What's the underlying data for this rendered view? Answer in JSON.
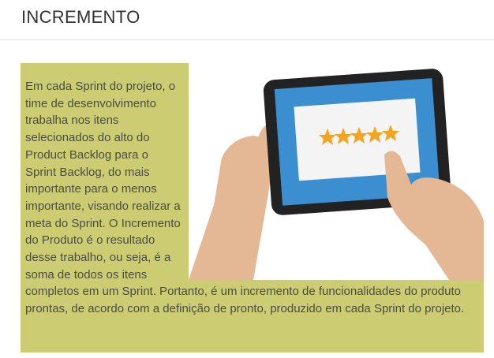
{
  "header": {
    "title": "INCREMENTO"
  },
  "content": {
    "paragraph": "Em cada Sprint do projeto, o time de desenvolvimento trabalha nos itens selecionados do alto do Product Backlog para o Sprint Backlog, do mais importante para o menos importante, visando realizar a meta do Sprint. O Incremento do Produto é o resultado desse trabalho, ou seja, é a soma de todos os itens completos em um Sprint. Portanto, é um incremento de funcionalidades do produto prontas, de acordo com a definição de pronto, produzido em cada Sprint do projeto."
  },
  "illustration": {
    "icon": "tablet-rating-icon",
    "stars": 5,
    "colors": {
      "card_background": "#cccd73",
      "skin": "#e5b895",
      "tablet_frame": "#222222",
      "screen": "#3b8fd0",
      "star": "#f3a51f"
    }
  }
}
